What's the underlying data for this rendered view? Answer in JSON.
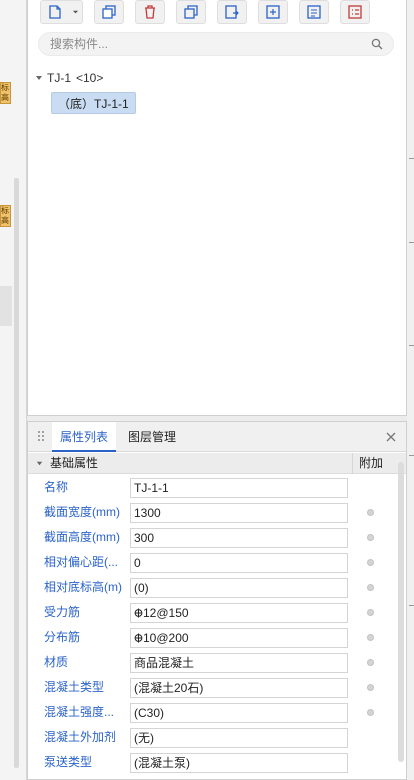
{
  "left_strip": {
    "chip1": "标高",
    "chip2": "标高"
  },
  "search": {
    "placeholder": "搜索构件..."
  },
  "tree": {
    "parent_label": "TJ-1",
    "parent_count": "<10>",
    "child_label": "（底）TJ-1-1"
  },
  "properties_panel": {
    "tabs": [
      "属性列表",
      "图层管理"
    ],
    "group_label": "基础属性",
    "extra_column": "附加",
    "rows": [
      {
        "name": "名称",
        "value": "TJ-1-1",
        "has_dot": false
      },
      {
        "name": "截面宽度(mm)",
        "value": "1300",
        "has_dot": true
      },
      {
        "name": "截面高度(mm)",
        "value": "300",
        "has_dot": true
      },
      {
        "name": "相对偏心距(...",
        "value": "0",
        "has_dot": true
      },
      {
        "name": "相对底标高(m)",
        "value": "(0)",
        "has_dot": true
      },
      {
        "name": "受力筋",
        "value": "12@150",
        "has_dot": true,
        "steel_symbol": true
      },
      {
        "name": "分布筋",
        "value": "10@200",
        "has_dot": true,
        "steel_symbol": true
      },
      {
        "name": "材质",
        "value": "商品混凝土",
        "has_dot": true
      },
      {
        "name": "混凝土类型",
        "value": "(混凝土20石)",
        "has_dot": true
      },
      {
        "name": "混凝土强度...",
        "value": "(C30)",
        "has_dot": true
      },
      {
        "name": "混凝土外加剂",
        "value": "(无)",
        "has_dot": false
      },
      {
        "name": "泵送类型",
        "value": "(混凝土泵)",
        "has_dot": false
      }
    ]
  },
  "colors": {
    "accent": "#2b63c9",
    "selection": "#c9dcf2",
    "toolbar_icon": "#2b63c9"
  }
}
